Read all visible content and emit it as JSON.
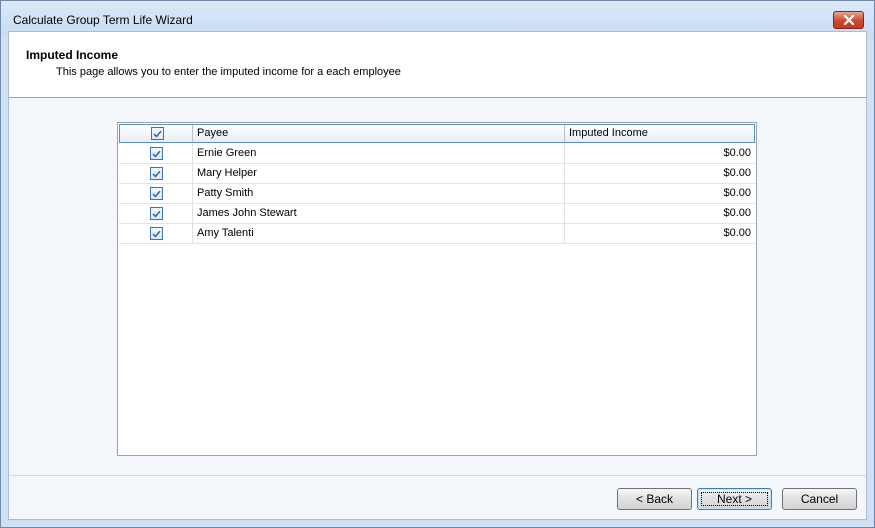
{
  "window": {
    "title": "Calculate Group Term Life Wizard"
  },
  "header": {
    "title": "Imputed Income",
    "subtitle": "This page allows you to enter the imputed income for a each employee"
  },
  "grid": {
    "columns": [
      "",
      "Payee",
      "Imputed Income"
    ],
    "select_all_checked": true,
    "rows": [
      {
        "checked": true,
        "payee": "Ernie Green",
        "amount": "$0.00"
      },
      {
        "checked": true,
        "payee": "Mary Helper",
        "amount": "$0.00"
      },
      {
        "checked": true,
        "payee": "Patty Smith",
        "amount": "$0.00"
      },
      {
        "checked": true,
        "payee": "James John Stewart",
        "amount": "$0.00"
      },
      {
        "checked": true,
        "payee": "Amy Talenti",
        "amount": "$0.00"
      }
    ]
  },
  "buttons": {
    "back": "< Back",
    "next": "Next >",
    "cancel": "Cancel"
  },
  "colors": {
    "accent": "#3b73b9",
    "close_button": "#cc4a30"
  }
}
